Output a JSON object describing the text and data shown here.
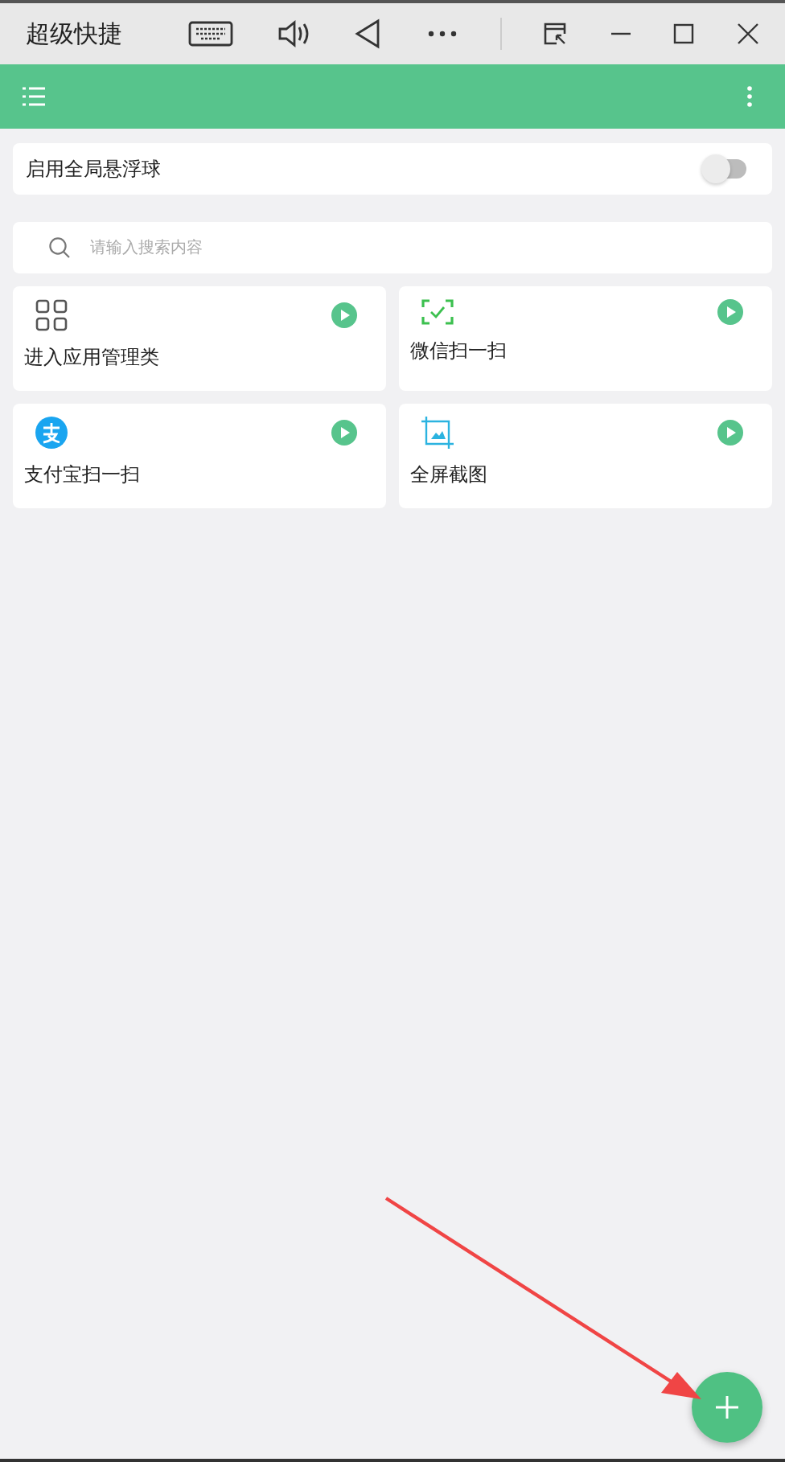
{
  "window": {
    "title": "超级快捷"
  },
  "floating_ball": {
    "label": "启用全局悬浮球",
    "on": false
  },
  "search": {
    "placeholder": "请输入搜索内容"
  },
  "shortcuts": [
    {
      "kind": "apps",
      "label": "进入应用管理类"
    },
    {
      "kind": "scan",
      "label": "微信扫一扫"
    },
    {
      "kind": "pay",
      "label": "支付宝扫一扫"
    },
    {
      "kind": "screenshot",
      "label": "全屏截图"
    }
  ]
}
